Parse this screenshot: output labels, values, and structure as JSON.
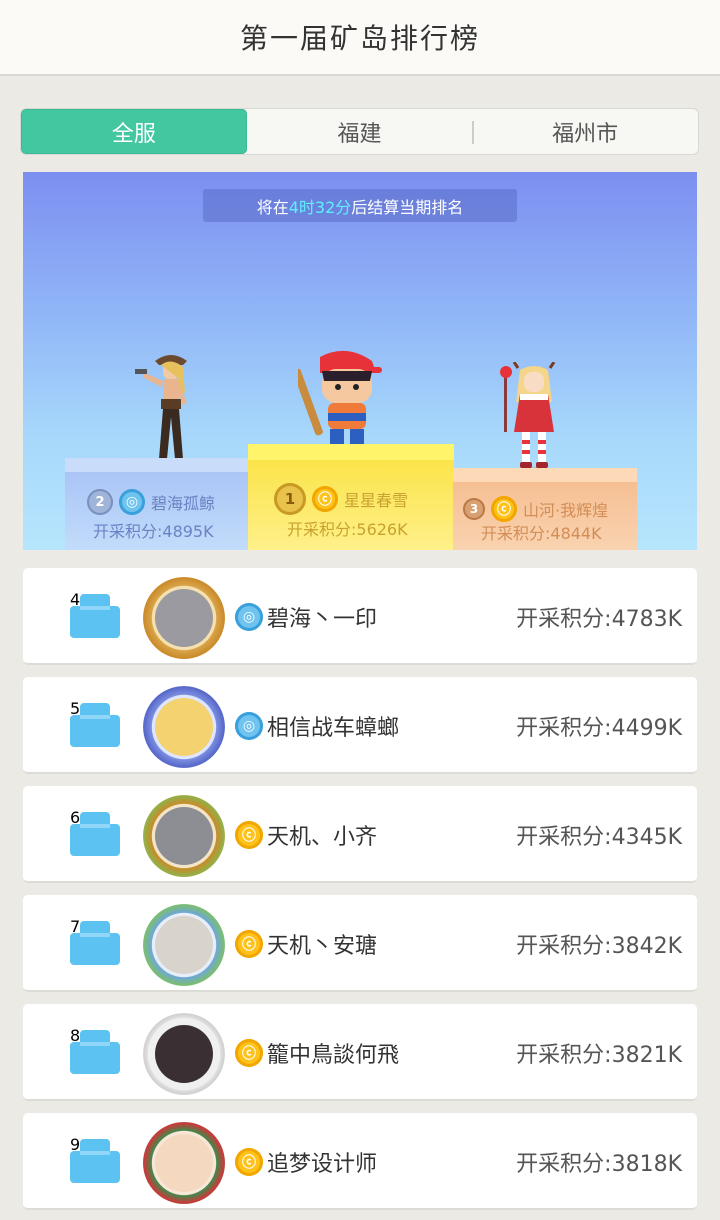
{
  "header": {
    "title": "第一届矿岛排行榜"
  },
  "tabs": [
    {
      "label": "全服",
      "active": true
    },
    {
      "label": "福建",
      "active": false
    },
    {
      "label": "福州市",
      "active": false
    }
  ],
  "banner": {
    "notice_prefix": "将在",
    "notice_time": "4时32分",
    "notice_suffix": "后结算当期排名",
    "top3": [
      {
        "rank": "2",
        "name": "碧海孤鲸",
        "score": "开采积分:4895K",
        "emblem": "blue"
      },
      {
        "rank": "1",
        "name": "星星春雪",
        "score": "开采积分:5626K",
        "emblem": "gold"
      },
      {
        "rank": "3",
        "name": "山河·我辉煌",
        "score": "开采积分:4844K",
        "emblem": "gold"
      }
    ]
  },
  "rankings": [
    {
      "rank": "4",
      "name": "碧海丶一印",
      "score": "开采积分:4783K",
      "emblem": "blue"
    },
    {
      "rank": "5",
      "name": "相信战车蟑螂",
      "score": "开采积分:4499K",
      "emblem": "blue"
    },
    {
      "rank": "6",
      "name": "天机、小齐",
      "score": "开采积分:4345K",
      "emblem": "gold"
    },
    {
      "rank": "7",
      "name": "天机丶安瑭",
      "score": "开采积分:3842K",
      "emblem": "gold"
    },
    {
      "rank": "8",
      "name": "籠中鳥談何飛",
      "score": "开采积分:3821K",
      "emblem": "gold"
    },
    {
      "rank": "9",
      "name": "追梦设计师",
      "score": "开采积分:3818K",
      "emblem": "gold"
    }
  ],
  "colors": {
    "accent": "#43c7a1",
    "blue_emblem": "#6fc3ef",
    "gold_emblem": "#ffc21a",
    "rank_badge": "#5cc2f2"
  }
}
